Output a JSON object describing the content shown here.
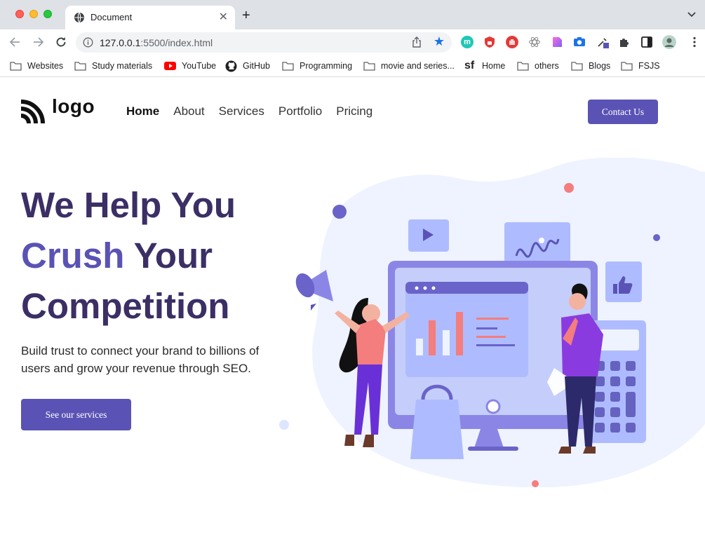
{
  "browser": {
    "tab_title": "Document",
    "url_host": "127.0.0.1",
    "url_rest": ":5500/index.html",
    "bookmarks": [
      "Websites",
      "Study materials",
      "YouTube",
      "GitHub",
      "Programming",
      "movie and series...",
      "Home",
      "others",
      "Blogs",
      "FSJS"
    ],
    "extensions": [
      "m"
    ]
  },
  "site": {
    "logo": "logo",
    "nav": [
      "Home",
      "About",
      "Services",
      "Portfolio",
      "Pricing"
    ],
    "active_nav": "Home",
    "contact_label": "Contact Us",
    "hero": {
      "line1": "We Help You",
      "line2_accent": "Crush",
      "line2_rest": " Your",
      "line3": "Competition",
      "paragraph": "Build trust to connect your brand to billions of users and grow your revenue through SEO.",
      "cta_label": "See our services"
    }
  },
  "colors": {
    "brand": "#5a53b5",
    "heading": "#3b2f65",
    "blob": "#eef3ff",
    "accent_red": "#f47d7d"
  }
}
